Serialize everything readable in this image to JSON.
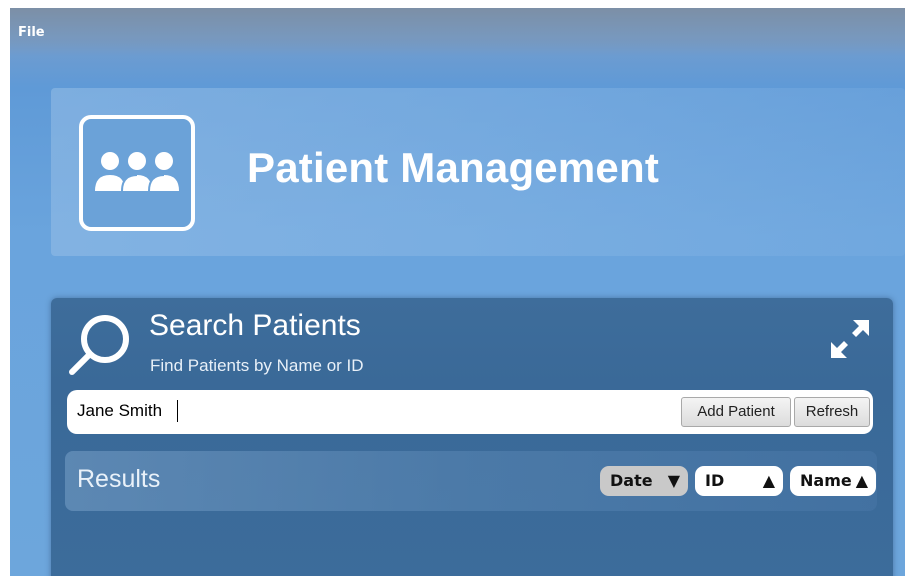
{
  "menu": {
    "file_label": "File"
  },
  "header": {
    "title": "Patient Management",
    "logo_icon": "people-group-icon"
  },
  "search": {
    "title": "Search Patients",
    "subtitle": "Find Patients by Name or ID",
    "input_value": "Jane Smith",
    "add_button_label": "Add Patient",
    "refresh_button_label": "Refresh",
    "search_icon": "magnifier-icon",
    "expand_icon": "expand-arrows-icon"
  },
  "results": {
    "label": "Results",
    "sort_buttons": [
      {
        "label": "Date",
        "arrow": "▼"
      },
      {
        "label": "ID",
        "arrow": "▲"
      },
      {
        "label": "Name",
        "arrow": "▲"
      }
    ]
  }
}
